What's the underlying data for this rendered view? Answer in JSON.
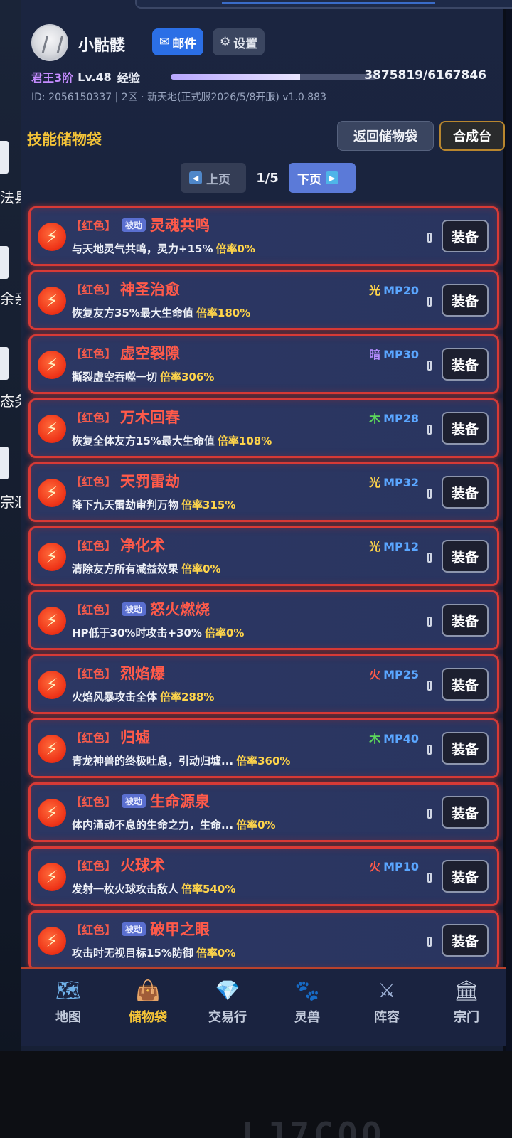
{
  "desktop": {
    "labels": [
      "法县",
      "余亲",
      "态务",
      "宗汇"
    ]
  },
  "profile": {
    "username": "小骷髅",
    "mail_label": "邮件",
    "settings_label": "设置",
    "rank": "君王3阶",
    "level": "Lv.48",
    "exp_label": "经验",
    "exp_text": "3875819/6167846",
    "exp_fraction": 0.628,
    "id_line": "ID: 2056150337 | 2区 · 新天地(正式服2026/5/8开服) v1.0.883"
  },
  "section": {
    "title": "技能储物袋",
    "back_label": "返回储物袋",
    "craft_label": "合成台"
  },
  "pager": {
    "prev_label": "上页",
    "page": "1/5",
    "next_label": "下页"
  },
  "skills": [
    {
      "tag": "【红色】",
      "passive": "被动",
      "name": "灵魂共鸣",
      "element": "",
      "element_color": "",
      "mp": "",
      "desc": "与天地灵气共鸣，灵力+15%",
      "rate": "倍率0%",
      "equip": "装备"
    },
    {
      "tag": "【红色】",
      "passive": "",
      "name": "神圣治愈",
      "element": "光",
      "element_color": "#ffd54a",
      "mp": "MP20",
      "desc": "恢复友方35%最大生命值",
      "rate": "倍率180%",
      "equip": "装备"
    },
    {
      "tag": "【红色】",
      "passive": "",
      "name": "虚空裂隙",
      "element": "暗",
      "element_color": "#b58cff",
      "mp": "MP30",
      "desc": "撕裂虚空吞噬一切",
      "rate": "倍率306%",
      "equip": "装备"
    },
    {
      "tag": "【红色】",
      "passive": "",
      "name": "万木回春",
      "element": "木",
      "element_color": "#5cd65c",
      "mp": "MP28",
      "desc": "恢复全体友方15%最大生命值",
      "rate": "倍率108%",
      "equip": "装备"
    },
    {
      "tag": "【红色】",
      "passive": "",
      "name": "天罚雷劫",
      "element": "光",
      "element_color": "#ffd54a",
      "mp": "MP32",
      "desc": "降下九天雷劫审判万物",
      "rate": "倍率315%",
      "equip": "装备"
    },
    {
      "tag": "【红色】",
      "passive": "",
      "name": "净化术",
      "element": "光",
      "element_color": "#ffd54a",
      "mp": "MP12",
      "desc": "清除友方所有减益效果",
      "rate": "倍率0%",
      "equip": "装备"
    },
    {
      "tag": "【红色】",
      "passive": "被动",
      "name": "怒火燃烧",
      "element": "",
      "element_color": "",
      "mp": "",
      "desc": "HP低于30%时攻击+30%",
      "rate": "倍率0%",
      "equip": "装备"
    },
    {
      "tag": "【红色】",
      "passive": "",
      "name": "烈焰爆",
      "element": "火",
      "element_color": "#ff5a4a",
      "mp": "MP25",
      "desc": "火焰风暴攻击全体",
      "rate": "倍率288%",
      "equip": "装备"
    },
    {
      "tag": "【红色】",
      "passive": "",
      "name": "归墟",
      "element": "木",
      "element_color": "#5cd65c",
      "mp": "MP40",
      "desc": "青龙神兽的终极吐息，引动归墟...",
      "rate": "倍率360%",
      "equip": "装备"
    },
    {
      "tag": "【红色】",
      "passive": "被动",
      "name": "生命源泉",
      "element": "",
      "element_color": "",
      "mp": "",
      "desc": "体内涌动不息的生命之力，生命...",
      "rate": "倍率0%",
      "equip": "装备"
    },
    {
      "tag": "【红色】",
      "passive": "",
      "name": "火球术",
      "element": "火",
      "element_color": "#ff5a4a",
      "mp": "MP10",
      "desc": "发射一枚火球攻击敌人",
      "rate": "倍率540%",
      "equip": "装备"
    },
    {
      "tag": "【红色】",
      "passive": "被动",
      "name": "破甲之眼",
      "element": "",
      "element_color": "",
      "mp": "",
      "desc": "攻击时无视目标15%防御",
      "rate": "倍率0%",
      "equip": "装备"
    }
  ],
  "nav": [
    {
      "label": "地图",
      "icon": "map-icon"
    },
    {
      "label": "储物袋",
      "icon": "bag-icon"
    },
    {
      "label": "交易行",
      "icon": "diamond-icon"
    },
    {
      "label": "灵兽",
      "icon": "beast-icon"
    },
    {
      "label": "阵容",
      "icon": "swords-icon"
    },
    {
      "label": "宗门",
      "icon": "temple-icon"
    }
  ]
}
